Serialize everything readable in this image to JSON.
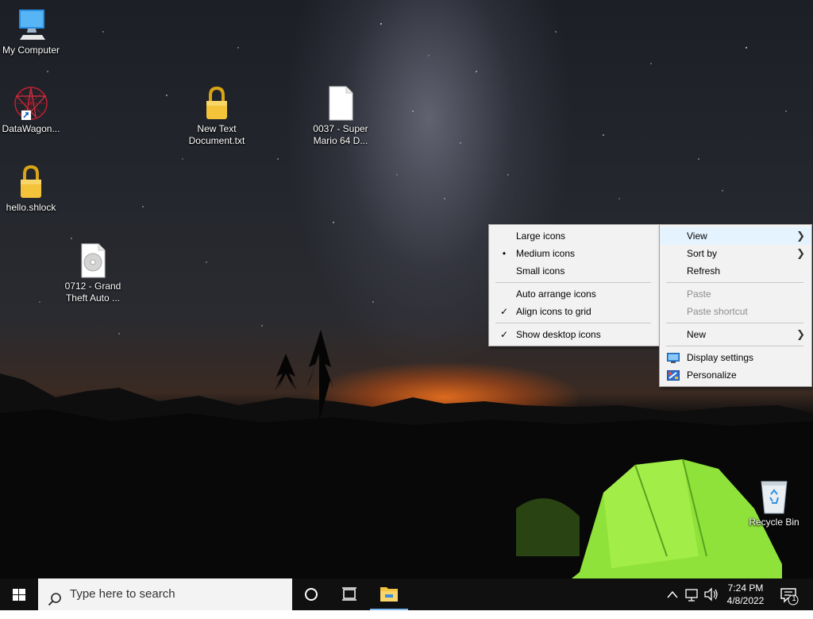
{
  "desktop": {
    "icons": [
      {
        "label": "My Computer",
        "icon": "my-computer-icon"
      },
      {
        "label": "DataWagon...",
        "icon": "datawagon-shortcut-icon"
      },
      {
        "label": "hello.shlock",
        "icon": "padlock-file-icon"
      },
      {
        "label": "New Text Document.txt",
        "icon": "padlock-file-icon"
      },
      {
        "label": "0037 - Super Mario 64 D...",
        "icon": "blank-file-icon"
      },
      {
        "label": "0712 - Grand Theft Auto ...",
        "icon": "disc-image-file-icon"
      },
      {
        "label": "Recycle Bin",
        "icon": "recycle-bin-icon"
      }
    ]
  },
  "context_menu": {
    "items": [
      {
        "label": "View",
        "submenu": true,
        "highlighted": true
      },
      {
        "label": "Sort by",
        "submenu": true
      },
      {
        "label": "Refresh"
      },
      {
        "label": "Paste",
        "disabled": true
      },
      {
        "label": "Paste shortcut",
        "disabled": true
      },
      {
        "label": "New",
        "submenu": true
      },
      {
        "label": "Display settings",
        "icon": "display-settings-icon"
      },
      {
        "label": "Personalize",
        "icon": "personalize-icon"
      }
    ]
  },
  "view_submenu": {
    "items": [
      {
        "label": "Large icons"
      },
      {
        "label": "Medium icons",
        "mark": "•"
      },
      {
        "label": "Small icons"
      },
      {
        "label": "Auto arrange icons"
      },
      {
        "label": "Align icons to grid",
        "mark": "✓"
      },
      {
        "label": "Show desktop icons",
        "mark": "✓"
      }
    ]
  },
  "taskbar": {
    "search_placeholder": "Type here to search",
    "clock_time": "7:24 PM",
    "clock_date": "4/8/2022",
    "notification_count": "1",
    "background": "#101010"
  },
  "colors": {
    "menu_background": "#f2f2f2",
    "menu_highlight": "#e5f3ff",
    "disabled_text": "#8d8d8d"
  }
}
